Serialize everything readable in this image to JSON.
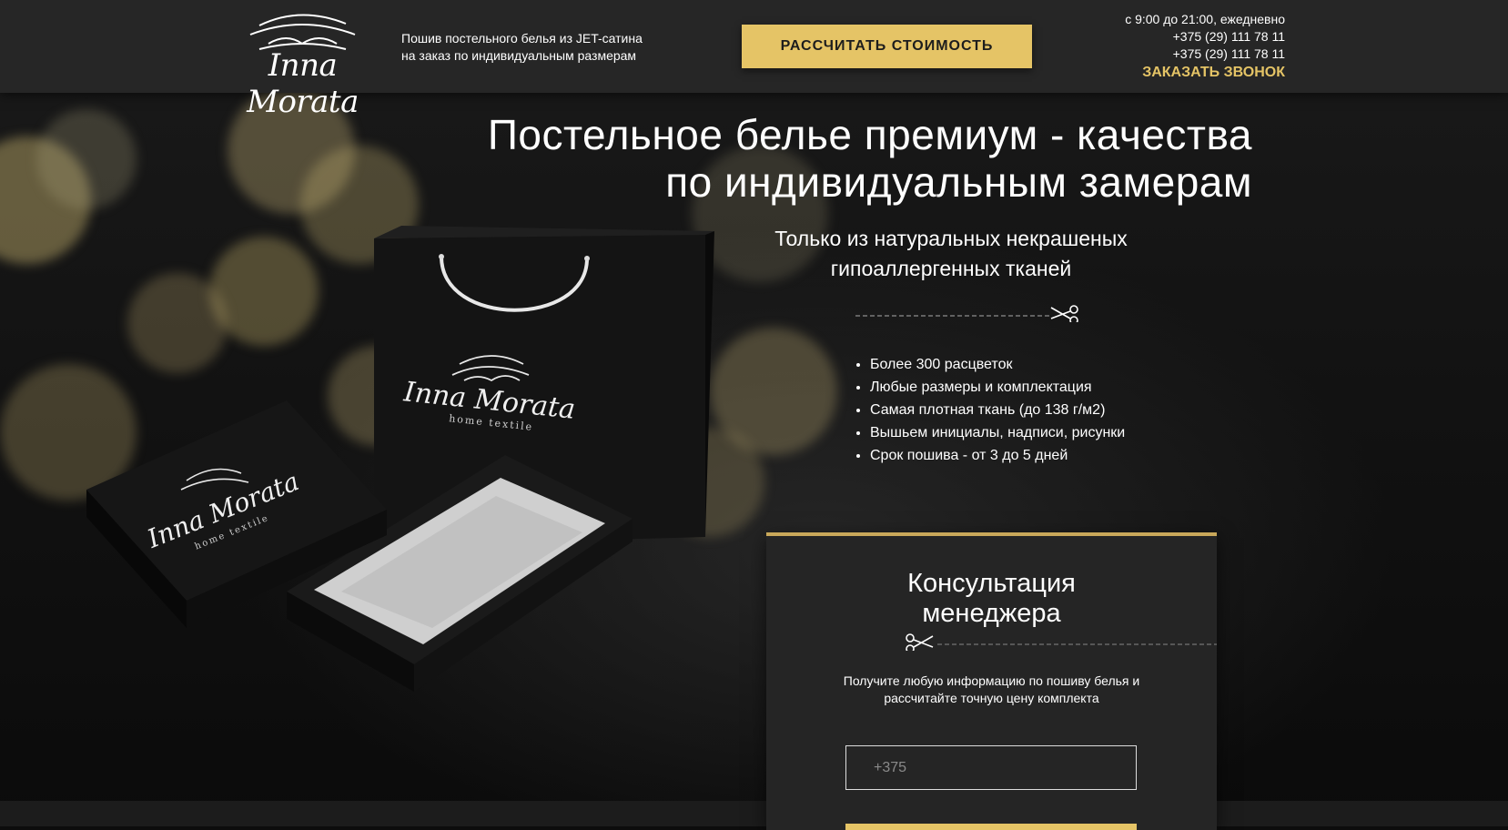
{
  "brand": {
    "logo_text": "Inna Morata",
    "product_logo_text": "Inna Morata",
    "product_logo_sub": "home textile"
  },
  "header": {
    "tagline_line1": "Пошив постельного белья из JET-сатина",
    "tagline_line2": "на заказ по индивидуальным размерам",
    "cta_label": "РАССЧИТАТЬ СТОИМОСТЬ",
    "hours": "с 9:00 до 21:00, ежедневно",
    "phone1": "+375 (29) 111 78 11",
    "phone2": "+375 (29) 111 78 11",
    "callback_label": "ЗАКАЗАТЬ ЗВОНОК"
  },
  "hero": {
    "headline_line1": "Постельное белье премиум - качества",
    "headline_line2": "по индивидуальным замерам",
    "subhead_line1": "Только из натуральных некрашеных",
    "subhead_line2": "гипоаллергенных тканей",
    "features": [
      "Более 300 расцветок",
      "Любые размеры и комплектация",
      "Самая плотная ткань (до 138 г/м2)",
      "Вышьем инициалы, надписи, рисунки",
      "Срок пошива - от 3 до 5 дней"
    ]
  },
  "form": {
    "title_line1": "Консультация",
    "title_line2": "менеджера",
    "desc_line1": "Получите любую информацию по пошиву белья и",
    "desc_line2": "рассчитайте точную цену комплекта",
    "phone_placeholder": "+375"
  },
  "colors": {
    "accent": "#e5c466",
    "header_bg": "#262626",
    "card_bg": "#252525",
    "card_border": "#c9a85a"
  },
  "icons": [
    "scissors-icon",
    "logo-mark-icon"
  ]
}
